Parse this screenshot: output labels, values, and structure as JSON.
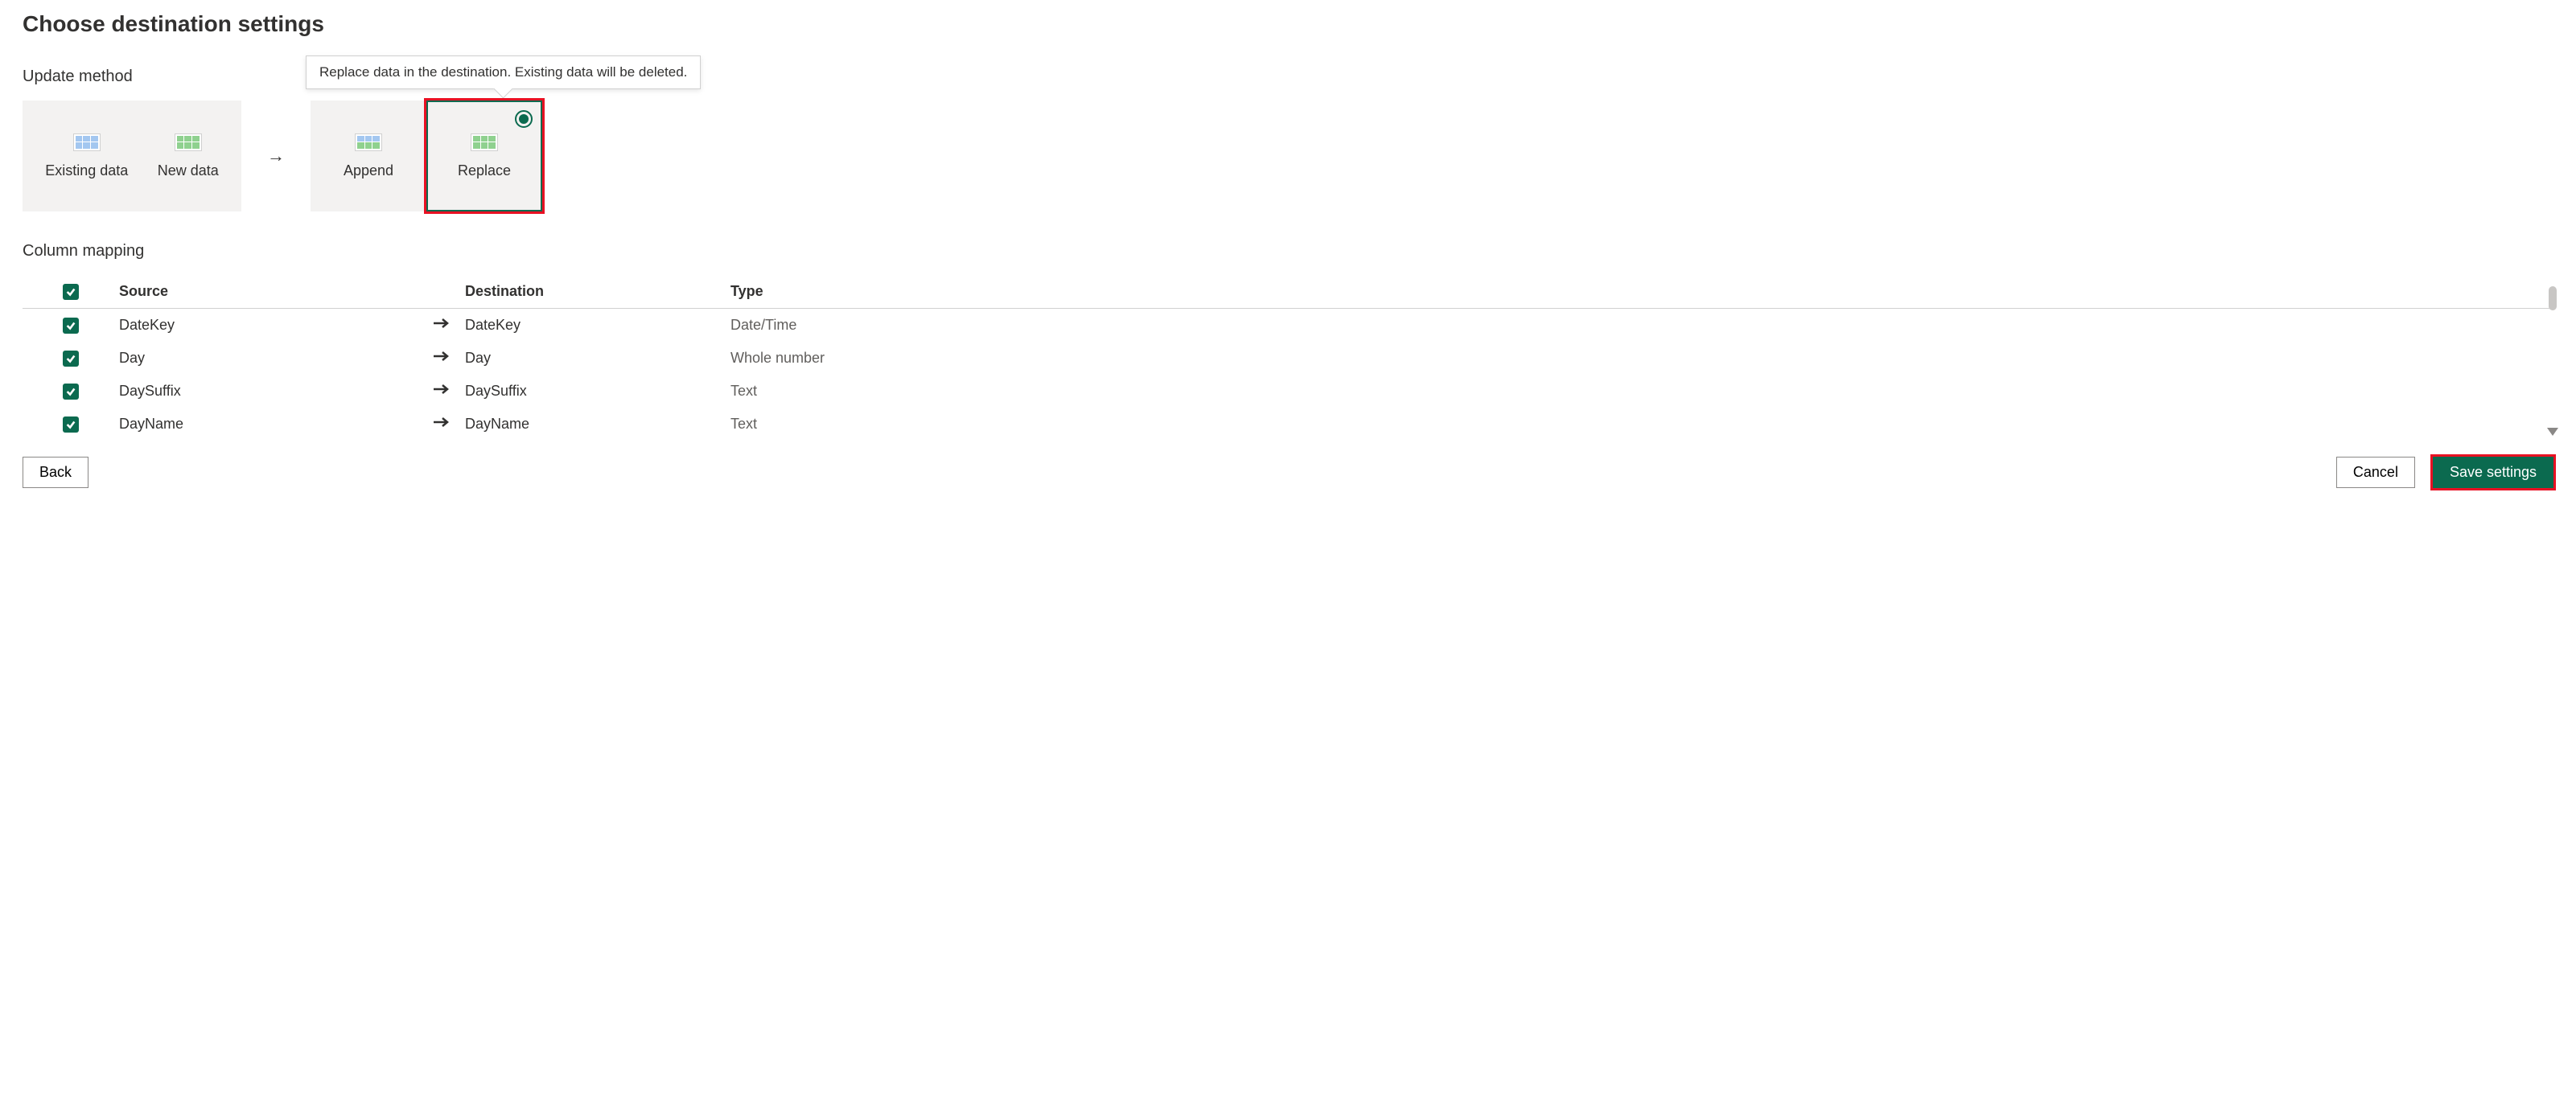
{
  "page_title": "Choose destination settings",
  "section_update_method": "Update method",
  "tooltip_text": "Replace data in the destination. Existing data will be deleted.",
  "legend": {
    "existing": "Existing data",
    "new": "New data"
  },
  "methods": {
    "append": "Append",
    "replace": "Replace",
    "selected": "replace"
  },
  "section_column_mapping": "Column mapping",
  "columns": {
    "source": "Source",
    "destination": "Destination",
    "type": "Type"
  },
  "rows": [
    {
      "checked": true,
      "source": "DateKey",
      "destination": "DateKey",
      "type": "Date/Time"
    },
    {
      "checked": true,
      "source": "Day",
      "destination": "Day",
      "type": "Whole number"
    },
    {
      "checked": true,
      "source": "DaySuffix",
      "destination": "DaySuffix",
      "type": "Text"
    },
    {
      "checked": true,
      "source": "DayName",
      "destination": "DayName",
      "type": "Text"
    }
  ],
  "buttons": {
    "back": "Back",
    "cancel": "Cancel",
    "save": "Save settings"
  },
  "colors": {
    "accent": "#0b6a4f",
    "highlight": "#e81123"
  }
}
